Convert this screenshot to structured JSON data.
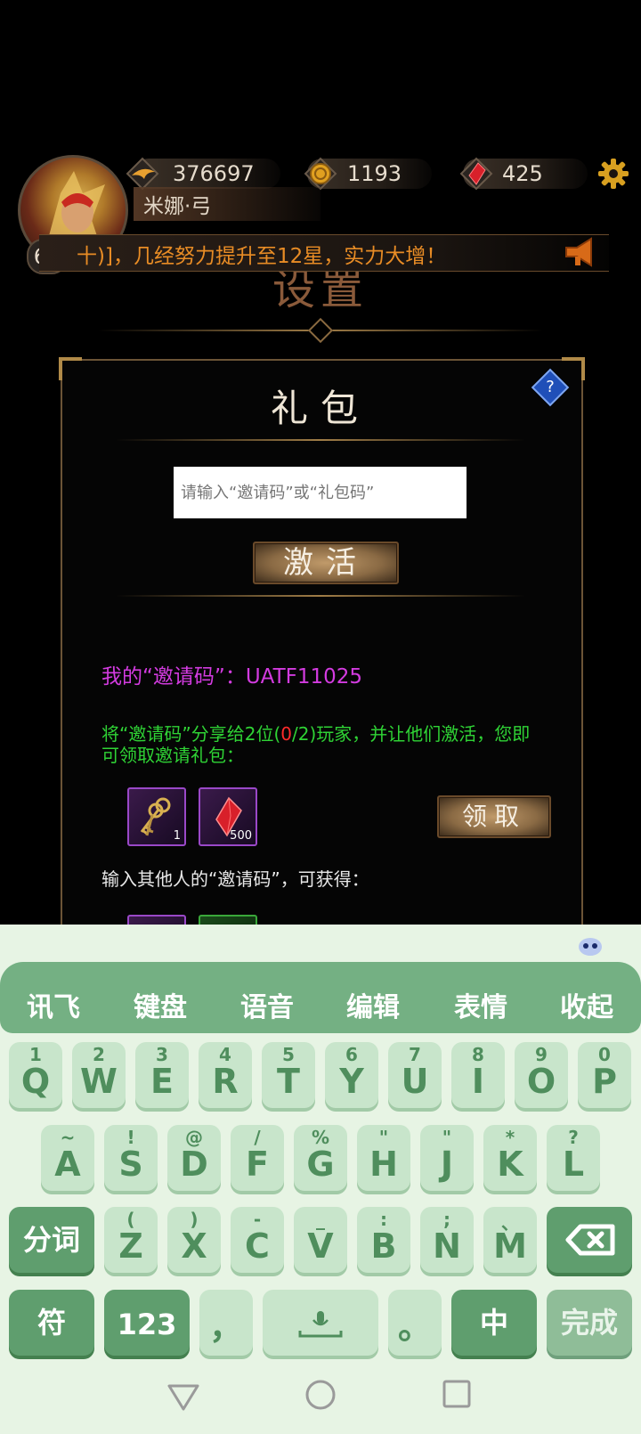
{
  "topbar": {
    "wings_value": "376697",
    "coins_value": "1193",
    "gems_value": "425",
    "player_name": "米娜·弓",
    "level": "60"
  },
  "banner": {
    "text": "十)]，几经努力提升至12星，实力大增！"
  },
  "settings_title": "设置",
  "gift_panel": {
    "title": "礼包",
    "help_label": "?",
    "code_placeholder": "请输入“邀请码”或“礼包码”",
    "activate_label": "激活",
    "my_code_text": "我的“邀请码”：UATF11025",
    "share_prefix": "将“邀请码”分享给2位(",
    "share_count": "0",
    "share_suffix": "/2)玩家，并让他们激活，您即可领取邀请礼包：",
    "rewards": [
      {
        "icon": "keys-icon",
        "count": "1"
      },
      {
        "icon": "red-gem-icon",
        "count": "500"
      }
    ],
    "claim_label": "领取",
    "enter_others_text": "输入其他人的“邀请码”，可获得："
  },
  "keyboard": {
    "toolbar": [
      "讯飞",
      "键盘",
      "语音",
      "编辑",
      "表情",
      "收起"
    ],
    "row1": [
      {
        "main": "Q",
        "sub": "1"
      },
      {
        "main": "W",
        "sub": "2"
      },
      {
        "main": "E",
        "sub": "3"
      },
      {
        "main": "R",
        "sub": "4"
      },
      {
        "main": "T",
        "sub": "5"
      },
      {
        "main": "Y",
        "sub": "6"
      },
      {
        "main": "U",
        "sub": "7"
      },
      {
        "main": "I",
        "sub": "8"
      },
      {
        "main": "O",
        "sub": "9"
      },
      {
        "main": "P",
        "sub": "0"
      }
    ],
    "row2": [
      {
        "main": "A",
        "sub": "~"
      },
      {
        "main": "S",
        "sub": "!"
      },
      {
        "main": "D",
        "sub": "@"
      },
      {
        "main": "F",
        "sub": "/"
      },
      {
        "main": "G",
        "sub": "%"
      },
      {
        "main": "H",
        "sub": "\""
      },
      {
        "main": "J",
        "sub": "\""
      },
      {
        "main": "K",
        "sub": "*"
      },
      {
        "main": "L",
        "sub": "?"
      }
    ],
    "row3": [
      {
        "main": "Z",
        "sub": "("
      },
      {
        "main": "X",
        "sub": ")"
      },
      {
        "main": "C",
        "sub": "-"
      },
      {
        "main": "V",
        "sub": "_"
      },
      {
        "main": "B",
        "sub": ":"
      },
      {
        "main": "N",
        "sub": ";"
      },
      {
        "main": "M",
        "sub": "、"
      }
    ],
    "fenci_label": "分词",
    "symbol_label": "符",
    "num_label": "123",
    "comma_label": "，",
    "period_label": "。",
    "zh_label": "中",
    "done_label": "完成"
  }
}
